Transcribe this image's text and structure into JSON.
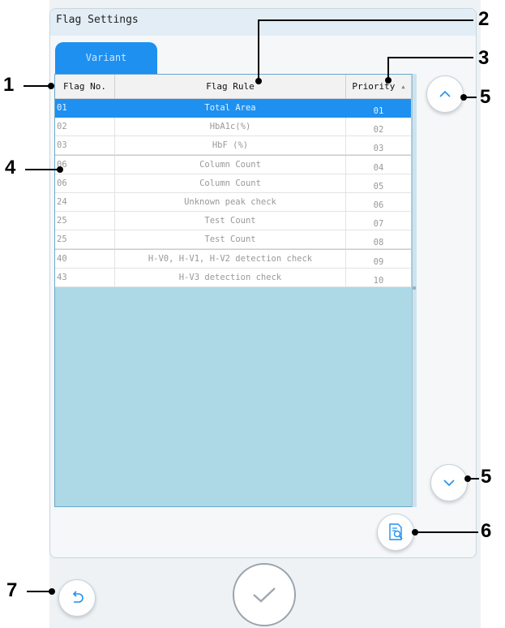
{
  "window": {
    "title": "Flag Settings"
  },
  "tabs": [
    {
      "label": "Variant"
    }
  ],
  "table": {
    "columns": {
      "flag_no": "Flag No.",
      "flag_rule": "Flag Rule",
      "priority": "Priority",
      "sort_indicator": "▲"
    },
    "rows": [
      {
        "no": "01",
        "rule": "Total Area",
        "priority": "01",
        "selected": true
      },
      {
        "no": "02",
        "rule": "HbA1c(%)",
        "priority": "02"
      },
      {
        "no": "03",
        "rule": "HbF (%)",
        "priority": "03"
      },
      {
        "no": "06",
        "rule": "Column Count",
        "priority": "04"
      },
      {
        "no": "06",
        "rule": "Column Count",
        "priority": "05"
      },
      {
        "no": "24",
        "rule": "Unknown peak check",
        "priority": "06"
      },
      {
        "no": "25",
        "rule": "Test Count",
        "priority": "07"
      },
      {
        "no": "25",
        "rule": "Test Count",
        "priority": "08"
      },
      {
        "no": "40",
        "rule": "H-V0, H-V1, H-V2 detection check",
        "priority": "09"
      },
      {
        "no": "43",
        "rule": "H-V3 detection check",
        "priority": "10"
      }
    ]
  },
  "buttons": {
    "scroll_up": "chevron-up-icon",
    "scroll_down": "chevron-down-icon",
    "details": "document-search-icon",
    "back": "undo-arrow-icon",
    "confirm": "checkmark-icon"
  },
  "callouts": [
    "1",
    "2",
    "3",
    "4",
    "5",
    "5",
    "6",
    "7"
  ],
  "colors": {
    "accent": "#1e90f0",
    "table_bg": "#add8e6",
    "titlebar": "#e2edf6"
  }
}
